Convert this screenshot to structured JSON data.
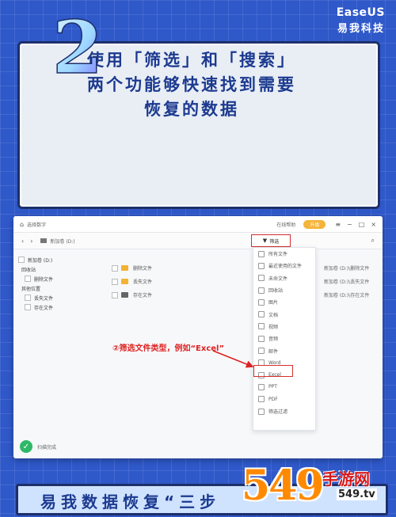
{
  "brand": {
    "en": "EaseUS",
    "cn": "易我科技"
  },
  "step_number": "2",
  "title": {
    "line1": "使用「筛选」和「搜索」",
    "line2": "两个功能够快速找到需要",
    "line3": "恢复的数据"
  },
  "app": {
    "window_title": "选择数字",
    "header_link": "在线帮助",
    "upgrade_label": "升级",
    "toolbar_location": "新加卷 (D:)",
    "filter_label": "筛选",
    "tree": [
      "新加卷 (D:)",
      "回收站",
      "删除文件",
      "其他位置",
      "丢失文件",
      "存在文件"
    ],
    "files": [
      "删除文件",
      "丢失文件",
      "存在文件"
    ],
    "filter_menu": [
      "所有文件",
      "最近使用的文件",
      "未命文件",
      "回收站",
      "图片",
      "文档",
      "视频",
      "音频",
      "邮件",
      "Word",
      "Excel",
      "PPT",
      "PDF",
      "筛选过滤"
    ],
    "right_column": [
      "新加卷 (D:)\\删除文件",
      "新加卷 (D:)\\丢失文件",
      "新加卷 (D:)\\存在文件"
    ],
    "annotation": "②筛选文件类型，例如“Excel”",
    "status_text": "扫描完成"
  },
  "footer": {
    "text": "易我数据恢复“三步"
  },
  "watermark": {
    "big": "549",
    "cn": "手游网",
    "sub": "549.tv"
  },
  "colors": {
    "background": "#2f58c9",
    "accent_red": "#d32f2f",
    "title_blue": "#1c3a8f"
  }
}
